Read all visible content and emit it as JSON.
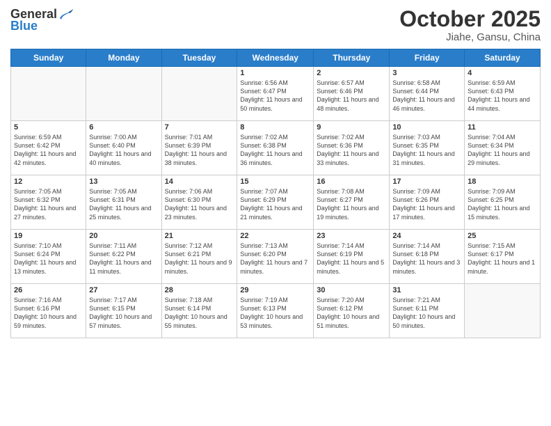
{
  "header": {
    "logo_general": "General",
    "logo_blue": "Blue",
    "title": "October 2025",
    "location": "Jiahe, Gansu, China"
  },
  "days_of_week": [
    "Sunday",
    "Monday",
    "Tuesday",
    "Wednesday",
    "Thursday",
    "Friday",
    "Saturday"
  ],
  "weeks": [
    [
      {
        "day": "",
        "sunrise": "",
        "sunset": "",
        "daylight": ""
      },
      {
        "day": "",
        "sunrise": "",
        "sunset": "",
        "daylight": ""
      },
      {
        "day": "",
        "sunrise": "",
        "sunset": "",
        "daylight": ""
      },
      {
        "day": "1",
        "sunrise": "Sunrise: 6:56 AM",
        "sunset": "Sunset: 6:47 PM",
        "daylight": "Daylight: 11 hours and 50 minutes."
      },
      {
        "day": "2",
        "sunrise": "Sunrise: 6:57 AM",
        "sunset": "Sunset: 6:46 PM",
        "daylight": "Daylight: 11 hours and 48 minutes."
      },
      {
        "day": "3",
        "sunrise": "Sunrise: 6:58 AM",
        "sunset": "Sunset: 6:44 PM",
        "daylight": "Daylight: 11 hours and 46 minutes."
      },
      {
        "day": "4",
        "sunrise": "Sunrise: 6:59 AM",
        "sunset": "Sunset: 6:43 PM",
        "daylight": "Daylight: 11 hours and 44 minutes."
      }
    ],
    [
      {
        "day": "5",
        "sunrise": "Sunrise: 6:59 AM",
        "sunset": "Sunset: 6:42 PM",
        "daylight": "Daylight: 11 hours and 42 minutes."
      },
      {
        "day": "6",
        "sunrise": "Sunrise: 7:00 AM",
        "sunset": "Sunset: 6:40 PM",
        "daylight": "Daylight: 11 hours and 40 minutes."
      },
      {
        "day": "7",
        "sunrise": "Sunrise: 7:01 AM",
        "sunset": "Sunset: 6:39 PM",
        "daylight": "Daylight: 11 hours and 38 minutes."
      },
      {
        "day": "8",
        "sunrise": "Sunrise: 7:02 AM",
        "sunset": "Sunset: 6:38 PM",
        "daylight": "Daylight: 11 hours and 36 minutes."
      },
      {
        "day": "9",
        "sunrise": "Sunrise: 7:02 AM",
        "sunset": "Sunset: 6:36 PM",
        "daylight": "Daylight: 11 hours and 33 minutes."
      },
      {
        "day": "10",
        "sunrise": "Sunrise: 7:03 AM",
        "sunset": "Sunset: 6:35 PM",
        "daylight": "Daylight: 11 hours and 31 minutes."
      },
      {
        "day": "11",
        "sunrise": "Sunrise: 7:04 AM",
        "sunset": "Sunset: 6:34 PM",
        "daylight": "Daylight: 11 hours and 29 minutes."
      }
    ],
    [
      {
        "day": "12",
        "sunrise": "Sunrise: 7:05 AM",
        "sunset": "Sunset: 6:32 PM",
        "daylight": "Daylight: 11 hours and 27 minutes."
      },
      {
        "day": "13",
        "sunrise": "Sunrise: 7:05 AM",
        "sunset": "Sunset: 6:31 PM",
        "daylight": "Daylight: 11 hours and 25 minutes."
      },
      {
        "day": "14",
        "sunrise": "Sunrise: 7:06 AM",
        "sunset": "Sunset: 6:30 PM",
        "daylight": "Daylight: 11 hours and 23 minutes."
      },
      {
        "day": "15",
        "sunrise": "Sunrise: 7:07 AM",
        "sunset": "Sunset: 6:29 PM",
        "daylight": "Daylight: 11 hours and 21 minutes."
      },
      {
        "day": "16",
        "sunrise": "Sunrise: 7:08 AM",
        "sunset": "Sunset: 6:27 PM",
        "daylight": "Daylight: 11 hours and 19 minutes."
      },
      {
        "day": "17",
        "sunrise": "Sunrise: 7:09 AM",
        "sunset": "Sunset: 6:26 PM",
        "daylight": "Daylight: 11 hours and 17 minutes."
      },
      {
        "day": "18",
        "sunrise": "Sunrise: 7:09 AM",
        "sunset": "Sunset: 6:25 PM",
        "daylight": "Daylight: 11 hours and 15 minutes."
      }
    ],
    [
      {
        "day": "19",
        "sunrise": "Sunrise: 7:10 AM",
        "sunset": "Sunset: 6:24 PM",
        "daylight": "Daylight: 11 hours and 13 minutes."
      },
      {
        "day": "20",
        "sunrise": "Sunrise: 7:11 AM",
        "sunset": "Sunset: 6:22 PM",
        "daylight": "Daylight: 11 hours and 11 minutes."
      },
      {
        "day": "21",
        "sunrise": "Sunrise: 7:12 AM",
        "sunset": "Sunset: 6:21 PM",
        "daylight": "Daylight: 11 hours and 9 minutes."
      },
      {
        "day": "22",
        "sunrise": "Sunrise: 7:13 AM",
        "sunset": "Sunset: 6:20 PM",
        "daylight": "Daylight: 11 hours and 7 minutes."
      },
      {
        "day": "23",
        "sunrise": "Sunrise: 7:14 AM",
        "sunset": "Sunset: 6:19 PM",
        "daylight": "Daylight: 11 hours and 5 minutes."
      },
      {
        "day": "24",
        "sunrise": "Sunrise: 7:14 AM",
        "sunset": "Sunset: 6:18 PM",
        "daylight": "Daylight: 11 hours and 3 minutes."
      },
      {
        "day": "25",
        "sunrise": "Sunrise: 7:15 AM",
        "sunset": "Sunset: 6:17 PM",
        "daylight": "Daylight: 11 hours and 1 minute."
      }
    ],
    [
      {
        "day": "26",
        "sunrise": "Sunrise: 7:16 AM",
        "sunset": "Sunset: 6:16 PM",
        "daylight": "Daylight: 10 hours and 59 minutes."
      },
      {
        "day": "27",
        "sunrise": "Sunrise: 7:17 AM",
        "sunset": "Sunset: 6:15 PM",
        "daylight": "Daylight: 10 hours and 57 minutes."
      },
      {
        "day": "28",
        "sunrise": "Sunrise: 7:18 AM",
        "sunset": "Sunset: 6:14 PM",
        "daylight": "Daylight: 10 hours and 55 minutes."
      },
      {
        "day": "29",
        "sunrise": "Sunrise: 7:19 AM",
        "sunset": "Sunset: 6:13 PM",
        "daylight": "Daylight: 10 hours and 53 minutes."
      },
      {
        "day": "30",
        "sunrise": "Sunrise: 7:20 AM",
        "sunset": "Sunset: 6:12 PM",
        "daylight": "Daylight: 10 hours and 51 minutes."
      },
      {
        "day": "31",
        "sunrise": "Sunrise: 7:21 AM",
        "sunset": "Sunset: 6:11 PM",
        "daylight": "Daylight: 10 hours and 50 minutes."
      },
      {
        "day": "",
        "sunrise": "",
        "sunset": "",
        "daylight": ""
      }
    ]
  ]
}
